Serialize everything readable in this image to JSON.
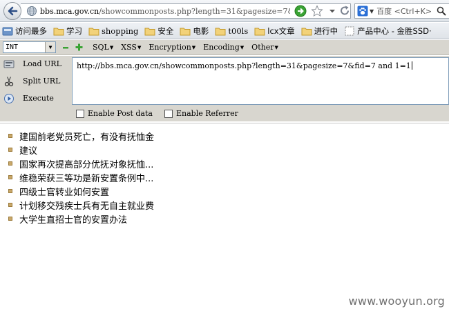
{
  "nav": {
    "url_prefix": "bbs.mca.gov.cn",
    "url_path": "/showcommonposts.php?length=31&pagesize=7&fid=7",
    "search_text": "百度 <Ctrl+K>"
  },
  "bookmarks": [
    {
      "label": "访问最多",
      "icon": "bookmark-folder-blue-icon"
    },
    {
      "label": "学习",
      "icon": "folder-icon"
    },
    {
      "label": "shopping",
      "icon": "folder-icon"
    },
    {
      "label": "安全",
      "icon": "folder-icon"
    },
    {
      "label": "电影",
      "icon": "folder-icon"
    },
    {
      "label": "t00ls",
      "icon": "folder-icon"
    },
    {
      "label": "lcx文章",
      "icon": "folder-icon"
    },
    {
      "label": "进行中",
      "icon": "folder-icon"
    },
    {
      "label": "产品中心 - 金胜SSD·",
      "icon": "page-icon"
    }
  ],
  "hackbar": {
    "select_value": "INT",
    "menus": [
      "SQL",
      "XSS",
      "Encryption",
      "Encoding",
      "Other"
    ],
    "load_url": "Load URL",
    "split_url": "Split URL",
    "execute": "Execute",
    "url_value": "http://bbs.mca.gov.cn/showcommonposts.php?length=31&pagesize=7&fid=7 and 1=1",
    "enable_post": "Enable Post data",
    "enable_referrer": "Enable Referrer"
  },
  "posts": [
    "建国前老党员死亡，有没有抚恤金",
    "建议",
    "国家再次提高部分优抚对象抚恤...",
    "维稳荣获三等功是新安置条例中...",
    "四级士官转业如何安置",
    "计划移交残疾士兵有无自主就业费",
    "大学生直招士官的安置办法"
  ],
  "watermark": "www.wooyun.org"
}
